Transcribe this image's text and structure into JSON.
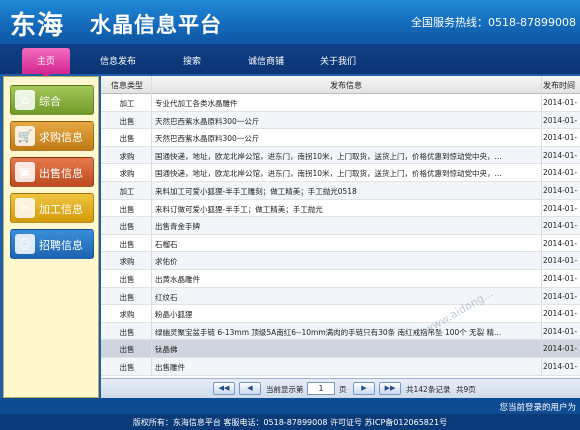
{
  "header": {
    "logo": "东海",
    "title": "水晶信息平台",
    "hotline": "全国服务热线：0518-87899008"
  },
  "nav": {
    "items": [
      "主页",
      "信息发布",
      "搜索",
      "诚信商铺",
      "关于我们"
    ]
  },
  "sidebar": {
    "items": [
      {
        "label": "综合",
        "icon": "home-icon"
      },
      {
        "label": "求购信息",
        "icon": "cart-icon"
      },
      {
        "label": "出售信息",
        "icon": "shop-icon"
      },
      {
        "label": "加工信息",
        "icon": "tools-icon"
      },
      {
        "label": "招聘信息",
        "icon": "people-icon"
      }
    ]
  },
  "table": {
    "columns": [
      "信息类型",
      "发布信息",
      "发布时间"
    ],
    "rows": [
      {
        "type": "加工",
        "info": "专业代加工各类水晶雕件",
        "time": "2014-01-"
      },
      {
        "type": "出售",
        "info": "天然巴西紫水晶原料300一公斤",
        "time": "2014-01-"
      },
      {
        "type": "出售",
        "info": "天然巴西紫水晶原料300一公斤",
        "time": "2014-01-"
      },
      {
        "type": "求购",
        "info": "国通快递，地址，欧龙北岸公馆，进东门，南拐10米，上门取货，送货上门，价格优惠到惊动党中央，...",
        "time": "2014-01-"
      },
      {
        "type": "求购",
        "info": "国通快递，地址，欧龙北岸公馆，进东门，南拐10米，上门取货，送货上门，价格优惠到惊动党中央，...",
        "time": "2014-01-"
      },
      {
        "type": "加工",
        "info": "来料加工可爱小狐狸-半手工雕刻；做工精美；手工抛光0518",
        "time": "2014-01-"
      },
      {
        "type": "出售",
        "info": "来料订做可爱小狐狸-半手工；做工精美；手工抛光",
        "time": "2014-01-"
      },
      {
        "type": "出售",
        "info": "出售青金手牌",
        "time": "2014-01-"
      },
      {
        "type": "出售",
        "info": "石榴石",
        "time": "2014-01-"
      },
      {
        "type": "求购",
        "info": "求佑价",
        "time": "2014-01-"
      },
      {
        "type": "出售",
        "info": "出黄水晶雕件",
        "time": "2014-01-"
      },
      {
        "type": "出售",
        "info": "红纹石",
        "time": "2014-01-"
      },
      {
        "type": "求购",
        "info": "粉晶小狐狸",
        "time": "2014-01-"
      },
      {
        "type": "出售",
        "info": "绿幽灵聚宝盆手链 6-13mm 顶级5A南红6--10mm满肉的手链只有30条  南红戒指吊坠  100个 无裂 精...",
        "time": "2014-01-"
      },
      {
        "type": "出售",
        "info": "钛晶佛",
        "time": "2014-01-"
      },
      {
        "type": "出售",
        "info": "出售雕件",
        "time": "2014-01-"
      }
    ]
  },
  "pager": {
    "first": "◀◀",
    "prev": "◀",
    "current_label": "当前显示第",
    "page": "1",
    "page_suffix": "页",
    "next": "▶",
    "last": "▶▶",
    "total_records": "共142条记录",
    "total_pages": "共9页"
  },
  "status": {
    "user": "您当前登录的用户为"
  },
  "footer": {
    "text": "版权所有：东海信息平台 客服电话：0518-87899008 许可证号 苏ICP备012065821号"
  },
  "watermark": "www.aidong..."
}
